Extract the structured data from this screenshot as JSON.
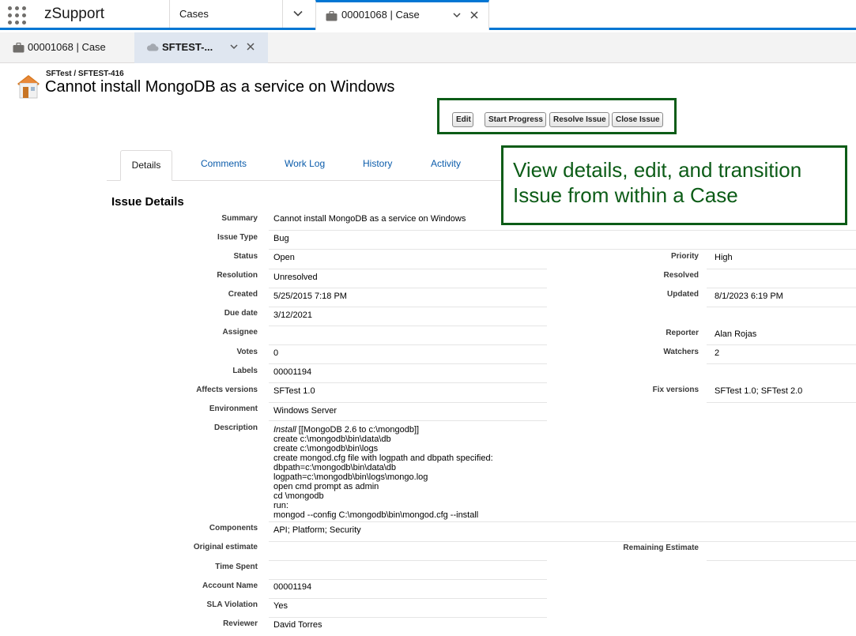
{
  "app": {
    "name": "zSupport"
  },
  "nav": {
    "cases_label": "Cases",
    "active_tab_label": "00001068 | Case"
  },
  "subtabs": {
    "case_label": "00001068 | Case",
    "issue_label": "SFTEST-..."
  },
  "issue": {
    "breadcrumb": "SFTest / SFTEST-416",
    "title": "Cannot install MongoDB as a service on Windows"
  },
  "actions": {
    "edit": "Edit",
    "start_progress": "Start Progress",
    "resolve_issue": "Resolve Issue",
    "close_issue": "Close Issue"
  },
  "callout": {
    "text": "View details, edit, and transition Issue from within a Case"
  },
  "tabs": {
    "details": "Details",
    "comments": "Comments",
    "work_log": "Work Log",
    "history": "History",
    "activity": "Activity"
  },
  "section_title": "Issue Details",
  "fields": {
    "summary": {
      "label": "Summary",
      "value": "Cannot install MongoDB as a service on Windows"
    },
    "issue_type": {
      "label": "Issue Type",
      "value": "Bug"
    },
    "status": {
      "label": "Status",
      "value": "Open"
    },
    "priority": {
      "label": "Priority",
      "value": "High"
    },
    "resolution": {
      "label": "Resolution",
      "value": "Unresolved"
    },
    "resolved": {
      "label": "Resolved",
      "value": ""
    },
    "created": {
      "label": "Created",
      "value": "5/25/2015 7:18 PM"
    },
    "updated": {
      "label": "Updated",
      "value": "8/1/2023 6:19 PM"
    },
    "due_date": {
      "label": "Due date",
      "value": "3/12/2021"
    },
    "assignee": {
      "label": "Assignee",
      "value": ""
    },
    "reporter": {
      "label": "Reporter",
      "value": "Alan Rojas"
    },
    "votes": {
      "label": "Votes",
      "value": "0"
    },
    "watchers": {
      "label": "Watchers",
      "value": "2"
    },
    "labels": {
      "label": "Labels",
      "value": "00001194"
    },
    "affects_versions": {
      "label": "Affects versions",
      "value": "SFTest 1.0"
    },
    "fix_versions": {
      "label": "Fix versions",
      "value": "SFTest 1.0; SFTest 2.0"
    },
    "environment": {
      "label": "Environment",
      "value": "Windows Server"
    },
    "description": {
      "label": "Description",
      "first_italic": "Install",
      "first_rest": " [[MongoDB 2.6 to c:\\mongodb]]",
      "lines": "create c:\\mongodb\\bin\\data\\db\ncreate c:\\mongodb\\bin\\logs\ncreate mongod.cfg file with logpath and dbpath specified:\ndbpath=c:\\mongodb\\bin\\data\\db\nlogpath=c:\\mongodb\\bin\\logs\\mongo.log\nopen cmd prompt as admin\ncd \\mongodb\nrun:\nmongod --config C:\\mongodb\\bin\\mongod.cfg --install"
    },
    "components": {
      "label": "Components",
      "value": "API; Platform; Security"
    },
    "original_estimate": {
      "label": "Original estimate",
      "value": ""
    },
    "remaining_estimate": {
      "label": "Remaining Estimate",
      "value": ""
    },
    "time_spent": {
      "label": "Time Spent",
      "value": ""
    },
    "account_name": {
      "label": "Account Name",
      "value": "00001194"
    },
    "sla_violation": {
      "label": "SLA Violation",
      "value": "Yes"
    },
    "reviewer": {
      "label": "Reviewer",
      "value": "David Torres"
    }
  }
}
